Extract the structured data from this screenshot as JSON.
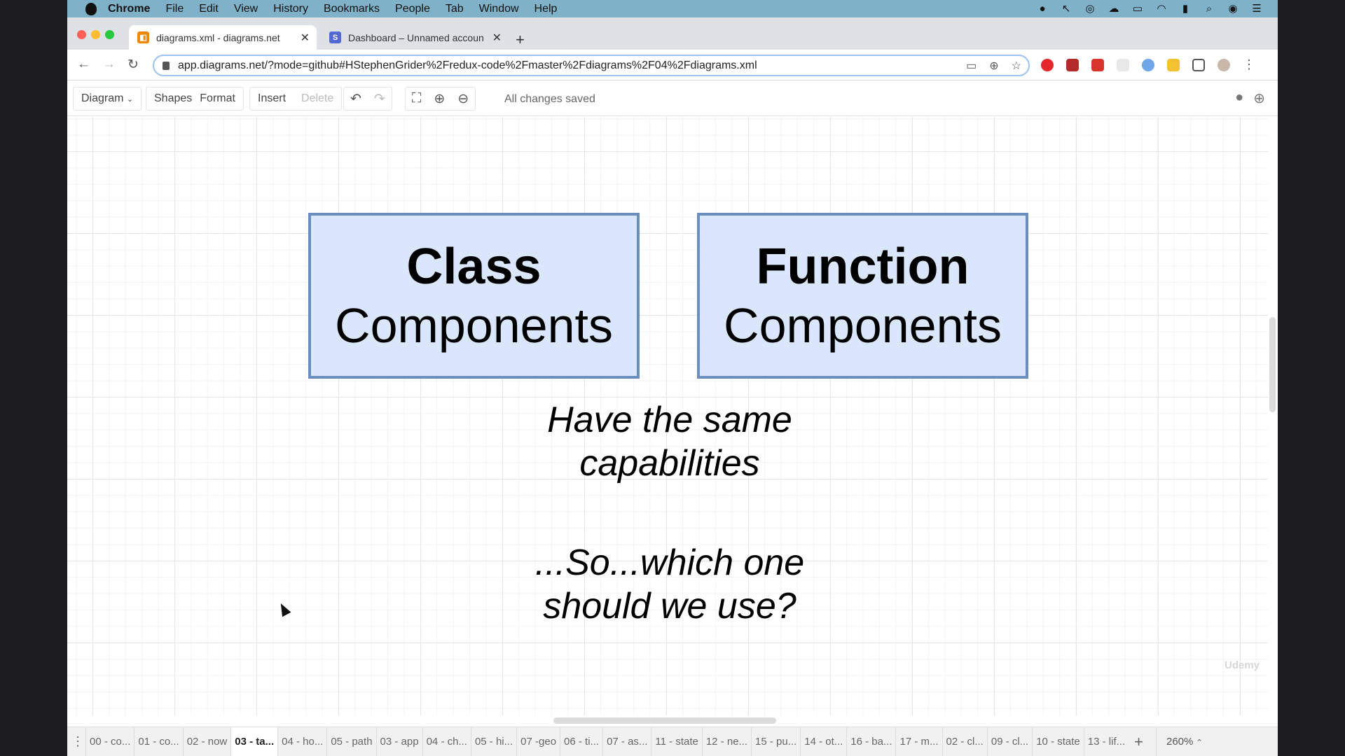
{
  "menubar": {
    "app": "Chrome",
    "items": [
      "File",
      "Edit",
      "View",
      "History",
      "Bookmarks",
      "People",
      "Tab",
      "Window",
      "Help"
    ]
  },
  "tabs": [
    {
      "title": "diagrams.xml - diagrams.net",
      "favicon_color": "#f08705",
      "active": true
    },
    {
      "title": "Dashboard – Unnamed accoun",
      "favicon_color": "#5469d4",
      "active": false
    }
  ],
  "address": {
    "url": "app.diagrams.net/?mode=github#HStephenGrider%2Fredux-code%2Fmaster%2Fdiagrams%2F04%2Fdiagrams.xml"
  },
  "toolbar": {
    "diagram_label": "Diagram",
    "shapes_label": "Shapes",
    "format_label": "Format",
    "insert_label": "Insert",
    "delete_label": "Delete",
    "status": "All changes saved"
  },
  "canvas": {
    "box1_bold": "Class",
    "box1_text": "Components",
    "box2_bold": "Function",
    "box2_text": "Components",
    "caption1_line1": "Have the same",
    "caption1_line2": "capabilities",
    "caption2_line1": "...So...which one",
    "caption2_line2": "should we use?",
    "watermark": "Udemy",
    "box_fill": "#dae6fb",
    "box_stroke": "#6c8ebf"
  },
  "footer": {
    "pages": [
      "00 - co...",
      "01 - co...",
      "02 - now",
      "03 - ta...",
      "04 - ho...",
      "05 - path",
      "03 - app",
      "04 - ch...",
      "05 - hi...",
      "07 -geo",
      "06 - ti...",
      "07 - as...",
      "11 - state",
      "12 - ne...",
      "15 - pu...",
      "14 - ot...",
      "16 - ba...",
      "17 - m...",
      "02 - cl...",
      "09 - cl...",
      "10 - state",
      "13 - lif..."
    ],
    "active_page": "03 - ta...",
    "zoom": "260%"
  }
}
